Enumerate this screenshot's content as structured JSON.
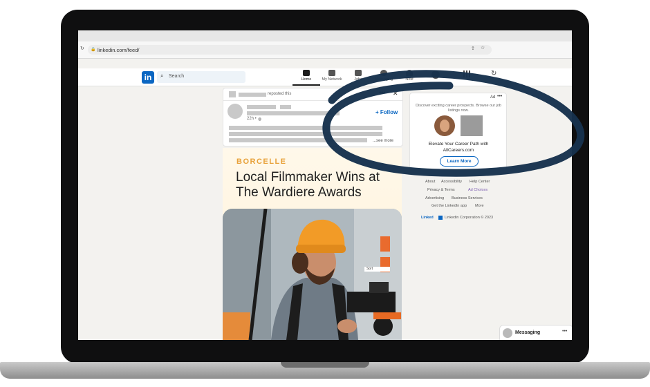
{
  "browser": {
    "url": "linkedin.com/feed/"
  },
  "nav": {
    "search_placeholder": "Search",
    "logo_text": "in",
    "items": [
      {
        "label": "Home",
        "icon": "home-icon",
        "active": true
      },
      {
        "label": "My Network",
        "icon": "network-icon",
        "active": false
      },
      {
        "label": "Jobs",
        "icon": "briefcase-icon",
        "active": false
      },
      {
        "label": "Messaging",
        "icon": "chat-icon",
        "active": false
      },
      {
        "label": "Notif",
        "icon": "bell-icon",
        "active": false
      }
    ]
  },
  "post": {
    "reposted": "reposted this",
    "follow_label": "+ Follow",
    "time": "22h •",
    "see_more": "...see more"
  },
  "ad": {
    "ad_label": "Ad",
    "description": "Discover exciting career prospects. Browse our job listings now.",
    "headline": "Elevate Your Career Path with AllCareers.com",
    "cta": "Learn More"
  },
  "featured": {
    "brand": "BORCELLE",
    "headline": "Local Filmmaker Wins at The Wardiere Awards",
    "sort_label": "Sort"
  },
  "footer": {
    "row1": [
      "About",
      "Accessibility",
      "Help Center"
    ],
    "row2": [
      "Privacy & Terms",
      "Ad Choices"
    ],
    "row3": [
      "Advertising",
      "Business Services"
    ],
    "row4": [
      "Get the LinkedIn app",
      "More"
    ],
    "copyright": "Linkedin Corporation © 2023",
    "brand_word": "Linked"
  },
  "messaging": {
    "label": "Messaging"
  },
  "colors": {
    "linkedin_blue": "#0a66c2",
    "brand_orange": "#e8a23b",
    "ink_circle": "#17324d"
  }
}
